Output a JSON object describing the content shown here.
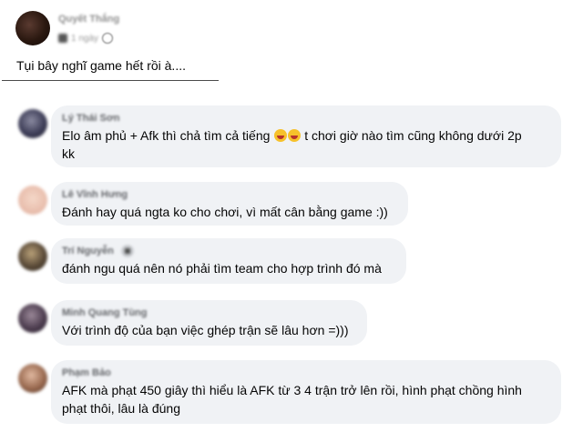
{
  "post": {
    "author": "Quyết Thắng",
    "time": "1 ngày",
    "text": "Tụi bây nghĩ game hết rồi à...."
  },
  "comments": [
    {
      "author": "Lý Thái Sơn",
      "line1": "Elo âm phủ + Afk thì chả tìm cả tiếng",
      "line1_after": "t chơi giờ nào tìm cũng không dưới 2p",
      "line2": "kk",
      "emoji": "laughing-tears-emoji"
    },
    {
      "author": "Lê Vĩnh Hưng",
      "text": "Đánh hay quá ngta ko cho chơi, vì mất cân bằng game :))"
    },
    {
      "author": "Trí Nguyễn",
      "text": "đánh ngu quá nên nó phải tìm team cho hợp trình đó mà"
    },
    {
      "author": "Minh Quang Tùng",
      "text": "Với trình độ của bạn việc ghép trận sẽ lâu hơn =)))"
    },
    {
      "author": "Phạm Bảo",
      "line1": "AFK mà phạt 450 giây thì hiểu là AFK từ 3 4 trận trở lên rồi, hình phạt chồng hình",
      "line2": "phạt thôi, lâu là đúng"
    }
  ],
  "colors": {
    "bubble": "#f0f2f5",
    "name": "#65676b",
    "text": "#050505"
  }
}
